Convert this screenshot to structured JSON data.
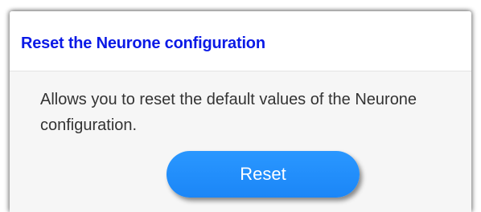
{
  "panel": {
    "title": "Reset the Neurone configuration",
    "description": "Allows you to reset the default values of the Neurone configuration.",
    "reset_label": "Reset"
  },
  "colors": {
    "title": "#0a19e6",
    "button": "#1b86f7",
    "button_text": "#ffffff",
    "background": "#f6f6f6"
  }
}
